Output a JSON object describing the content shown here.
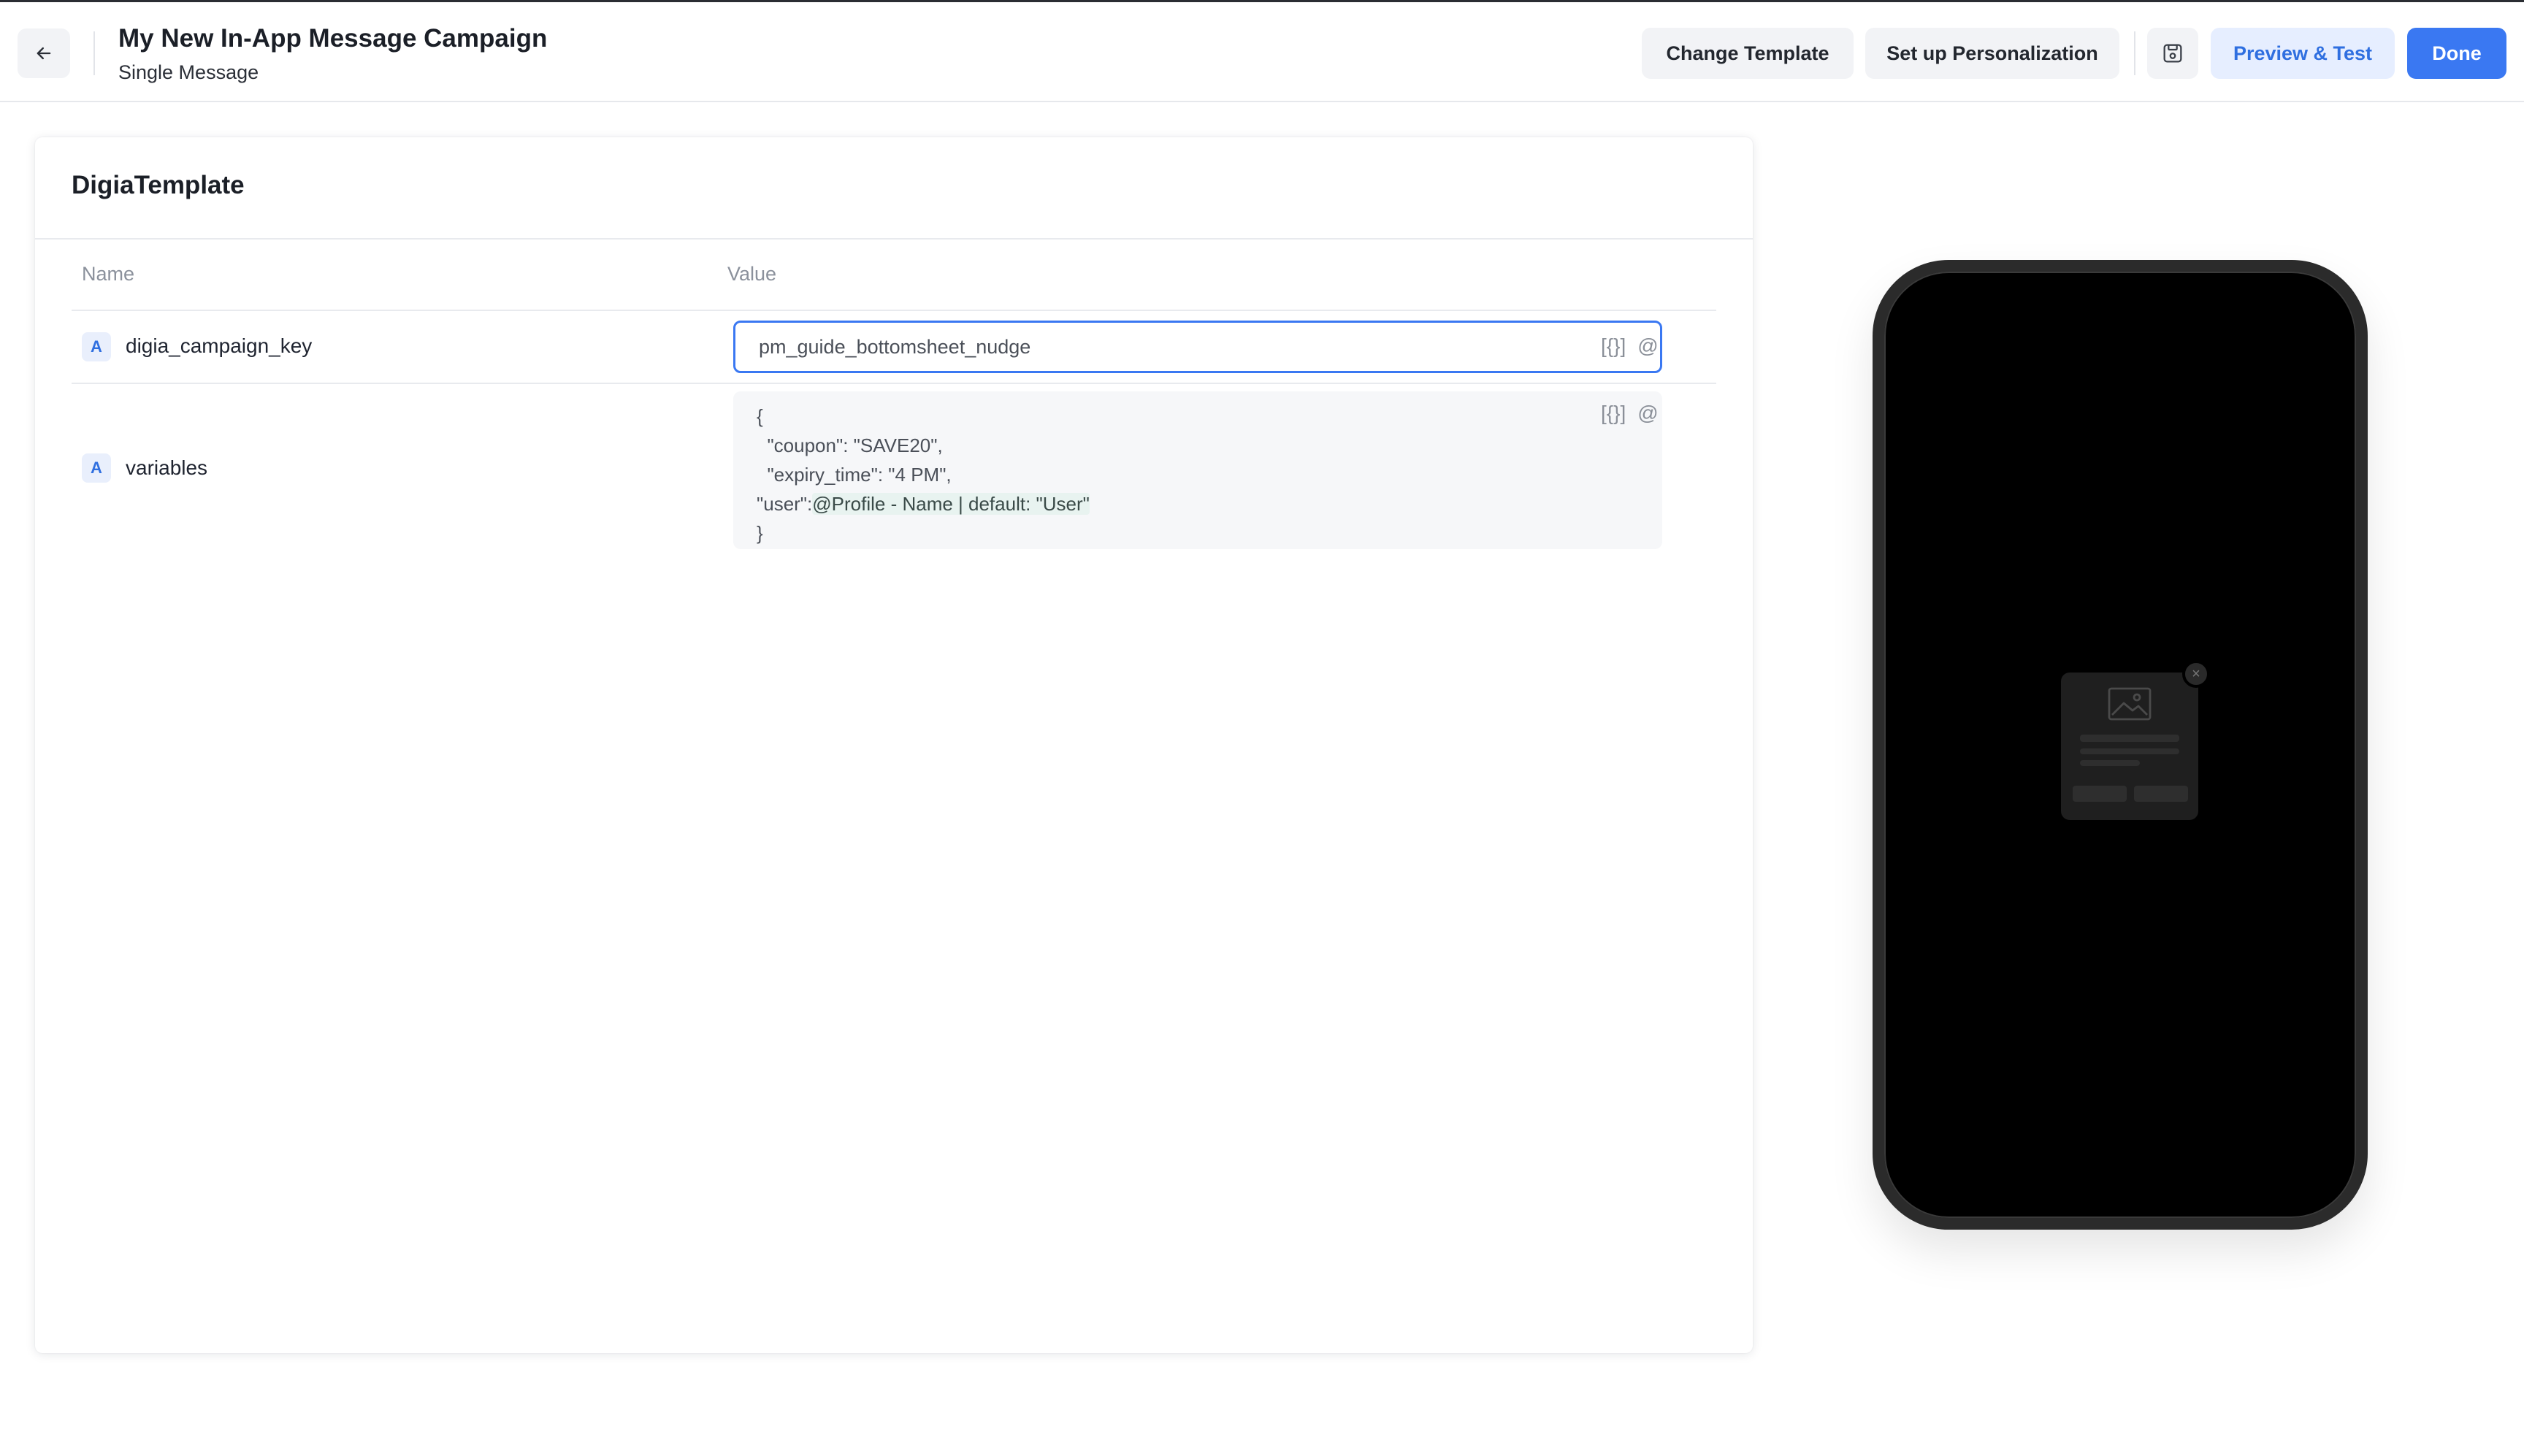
{
  "header": {
    "back_icon": "arrow-left-icon",
    "title": "My New In-App Message Campaign",
    "subtitle": "Single Message",
    "change_template_label": "Change Template",
    "personalization_label": "Set up Personalization",
    "save_icon": "save-draft-icon",
    "preview_label": "Preview & Test",
    "done_label": "Done"
  },
  "template": {
    "title": "DigiaTemplate",
    "columns": {
      "name": "Name",
      "value": "Value"
    },
    "rows": [
      {
        "type_badge": "A",
        "name": "digia_campaign_key",
        "value": "pm_guide_bottomsheet_nudge",
        "icons": {
          "braces": "[{}]",
          "mention": "@"
        }
      },
      {
        "type_badge": "A",
        "name": "variables",
        "value_lines": {
          "l1": "{",
          "l2": "  \"coupon\": \"SAVE20\",",
          "l3": "  \"expiry_time\": \"4 PM\",",
          "l4_prefix": "\"user\":",
          "l4_mention": "@Profile - Name | default: \"User\"",
          "l5": "}"
        },
        "icons": {
          "braces": "[{}]",
          "mention": "@"
        }
      }
    ]
  },
  "preview": {
    "device": "phone",
    "placeholder_icon": "image-placeholder-icon",
    "close_glyph": "×"
  },
  "colors": {
    "accent": "#3a78f2",
    "accent_soft": "#e6eeff",
    "badge_bg": "#e9effc",
    "mention_bg": "#e8f3f0"
  }
}
